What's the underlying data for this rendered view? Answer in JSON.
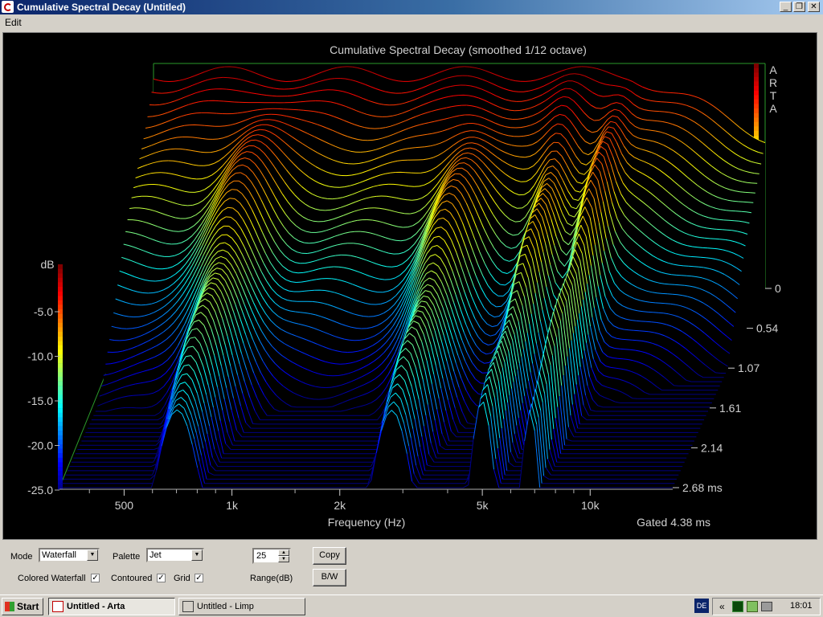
{
  "window": {
    "title": "Cumulative Spectral Decay  (Untitled)",
    "min_glyph": "_",
    "max_glyph": "❐",
    "close_glyph": "✕"
  },
  "menu": {
    "edit": "Edit"
  },
  "chart_data": {
    "type": "area",
    "title": "Cumulative Spectral Decay (smoothed 1/12 octave)",
    "watermark": "ARTA",
    "xlabel": "Frequency (Hz)",
    "x_ticks": [
      "500",
      "1k",
      "2k",
      "5k",
      "10k"
    ],
    "x_tick_values": [
      500,
      1000,
      2000,
      5000,
      10000
    ],
    "x_scale": "log",
    "zlabel": "dB",
    "z_ticks": [
      "-5.0",
      "-10.0",
      "-15.0",
      "-20.0",
      "-25.0"
    ],
    "z_range": [
      -25,
      0
    ],
    "time_ticks": [
      "0",
      "0.54",
      "1.07",
      "1.61",
      "2.14",
      "2.68 ms"
    ],
    "time_range_ms": [
      0,
      2.68
    ],
    "gate_label": "Gated 4.38 ms",
    "palette": "Jet",
    "slice_count": 48,
    "grid": true,
    "peaks_db_first_slice": [
      {
        "freq_hz": 700,
        "db": -1
      },
      {
        "freq_hz": 2800,
        "db": 0
      },
      {
        "freq_hz": 5000,
        "db": -1
      },
      {
        "freq_hz": 10000,
        "db": -8
      }
    ]
  },
  "controls": {
    "mode_label": "Mode",
    "mode_value": "Waterfall",
    "palette_label": "Palette",
    "palette_value": "Jet",
    "range_value": "25",
    "range_label": "Range(dB)",
    "copy_label": "Copy",
    "bw_label": "B/W",
    "colored_waterfall_label": "Colored Waterfall",
    "contoured_label": "Contoured",
    "grid_label": "Grid",
    "check_glyph": "✓"
  },
  "taskbar": {
    "start_label": "Start",
    "task1": "Untitled - Arta",
    "task2": "Untitled - Limp",
    "lang": "DE",
    "tray_arrows": "«",
    "time": "18:01"
  }
}
